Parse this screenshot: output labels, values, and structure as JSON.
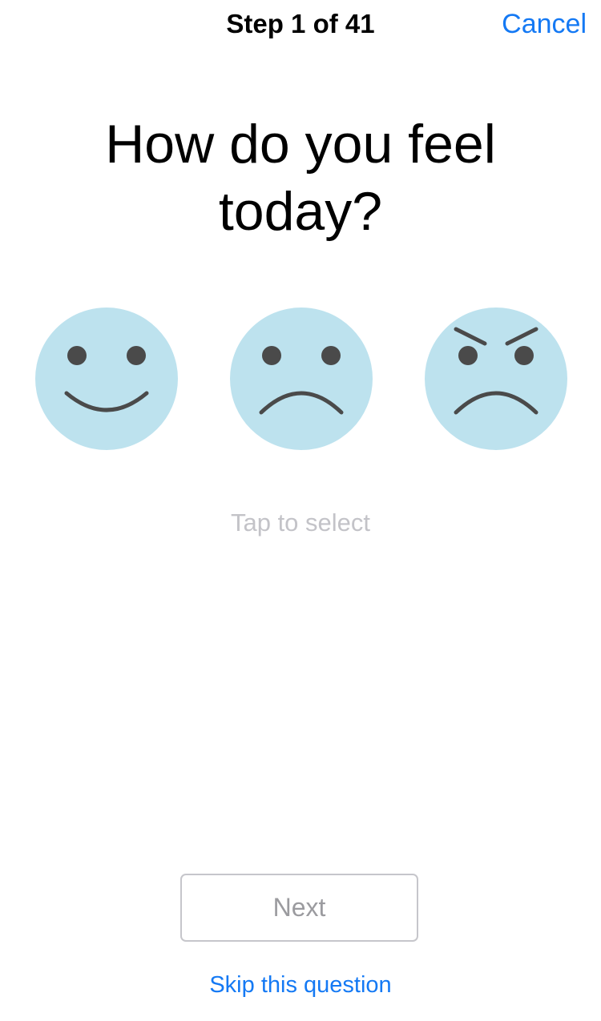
{
  "nav": {
    "step_label": "Step 1 of 41",
    "cancel_label": "Cancel"
  },
  "question": {
    "title": "How do you feel today?"
  },
  "faces": [
    {
      "icon": "happy-face-icon"
    },
    {
      "icon": "sad-face-icon"
    },
    {
      "icon": "angry-face-icon"
    }
  ],
  "hint": "Tap to select",
  "footer": {
    "next_label": "Next",
    "skip_label": "Skip this question"
  },
  "colors": {
    "accent": "#1479f4",
    "face_fill": "#bde2ee",
    "face_features": "#4a4a4a",
    "hint": "#c3c3c8",
    "button_border": "#c6c6cb",
    "button_text": "#9b9b9f"
  }
}
